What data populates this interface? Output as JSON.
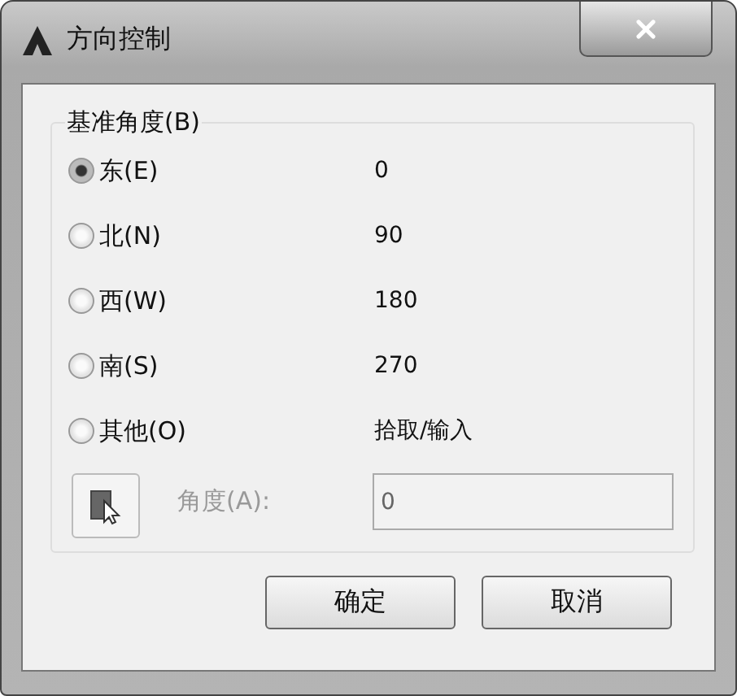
{
  "window": {
    "title": "方向控制"
  },
  "group": {
    "label": "基准角度(B)",
    "options": [
      {
        "label": "东(E)",
        "value": "0",
        "selected": true
      },
      {
        "label": "北(N)",
        "value": "90",
        "selected": false
      },
      {
        "label": "西(W)",
        "value": "180",
        "selected": false
      },
      {
        "label": "南(S)",
        "value": "270",
        "selected": false
      },
      {
        "label": "其他(O)",
        "value": "拾取/输入",
        "selected": false
      }
    ],
    "angle": {
      "label": "角度(A):",
      "value": "0",
      "disabled": true
    }
  },
  "buttons": [
    "确定",
    "取消"
  ]
}
